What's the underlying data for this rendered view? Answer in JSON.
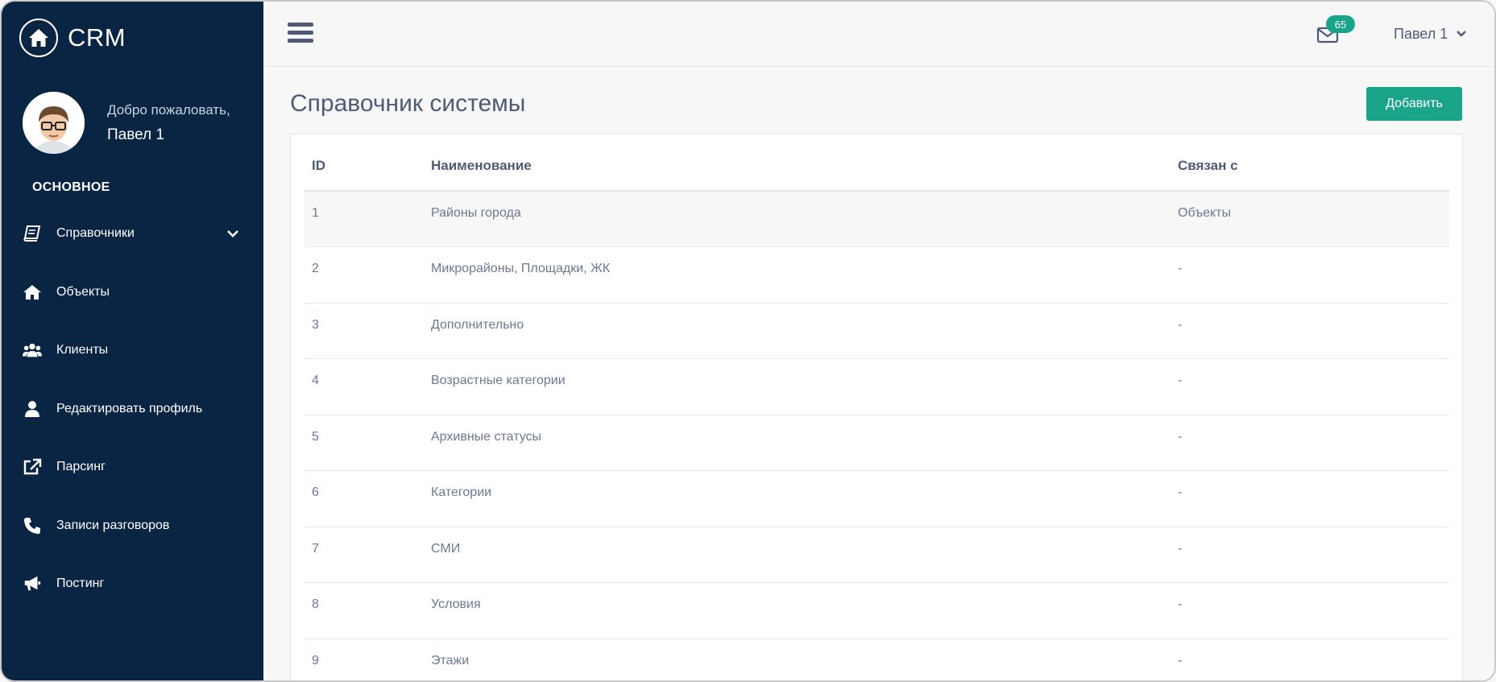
{
  "brand": {
    "name": "CRM"
  },
  "profile": {
    "welcome": "Добро пожаловать,",
    "name": "Павел 1"
  },
  "sidebar": {
    "section": "ОСНОВНОЕ",
    "items": [
      {
        "label": "Справочники",
        "icon": "book-icon",
        "has_chevron": true
      },
      {
        "label": "Объекты",
        "icon": "home-icon"
      },
      {
        "label": "Клиенты",
        "icon": "users-icon"
      },
      {
        "label": "Редактировать профиль",
        "icon": "user-icon"
      },
      {
        "label": "Парсинг",
        "icon": "external-link-icon"
      },
      {
        "label": "Записи разговоров",
        "icon": "phone-icon"
      },
      {
        "label": "Постинг",
        "icon": "megaphone-icon"
      }
    ]
  },
  "topbar": {
    "mail_count": "65",
    "user_name": "Павел 1"
  },
  "main": {
    "title": "Справочник системы",
    "add_label": "Добавить",
    "table": {
      "headers": [
        "ID",
        "Наименование",
        "Связан с"
      ],
      "rows": [
        [
          "1",
          "Районы города",
          "Объекты"
        ],
        [
          "2",
          "Микрорайоны, Площадки, ЖК",
          "-"
        ],
        [
          "3",
          "Дополнительно",
          "-"
        ],
        [
          "4",
          "Возрастные категории",
          "-"
        ],
        [
          "5",
          "Архивные статусы",
          "-"
        ],
        [
          "6",
          "Категории",
          "-"
        ],
        [
          "7",
          "СМИ",
          "-"
        ],
        [
          "8",
          "Условия",
          "-"
        ],
        [
          "9",
          "Этажи",
          "-"
        ]
      ]
    }
  },
  "colors": {
    "sidebar_bg": "#0a2544",
    "accent": "#1aa58a",
    "text_primary": "#4e5a78",
    "text_secondary": "#6c7894"
  }
}
